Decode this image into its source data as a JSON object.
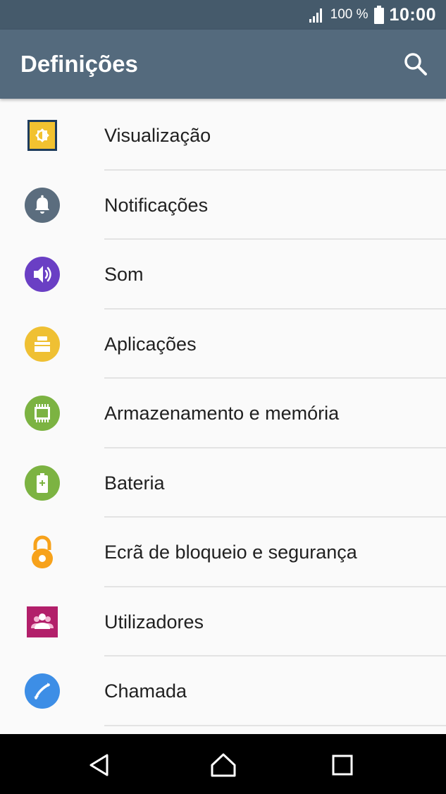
{
  "status_bar": {
    "battery_percent": "100 %",
    "time": "10:00"
  },
  "app_bar": {
    "title": "Definições"
  },
  "settings": {
    "items": [
      {
        "label": "Visualização"
      },
      {
        "label": "Notificações"
      },
      {
        "label": "Som"
      },
      {
        "label": "Aplicações"
      },
      {
        "label": "Armazenamento e memória"
      },
      {
        "label": "Bateria"
      },
      {
        "label": "Ecrã de bloqueio e segurança"
      },
      {
        "label": "Utilizadores"
      },
      {
        "label": "Chamada"
      }
    ]
  },
  "icons": {
    "display": "display-icon",
    "notifications": "bell-icon",
    "sound": "speaker-icon",
    "apps": "apps-icon",
    "storage": "memory-chip-icon",
    "battery": "battery-icon",
    "lock": "padlock-icon",
    "users": "users-icon",
    "call": "phone-icon"
  },
  "colors": {
    "status_bar": "#455a6b",
    "app_bar": "#546a7d",
    "background": "#fafafa",
    "display_icon": "#f2c230",
    "notifications_icon": "#5b6d7e",
    "sound_icon": "#6a3fc4",
    "apps_icon": "#efc033",
    "storage_icon": "#7cb342",
    "battery_icon": "#7cb342",
    "lock_icon": "#f7a21b",
    "users_icon": "#b21f6a",
    "call_icon": "#3d8ee6"
  }
}
